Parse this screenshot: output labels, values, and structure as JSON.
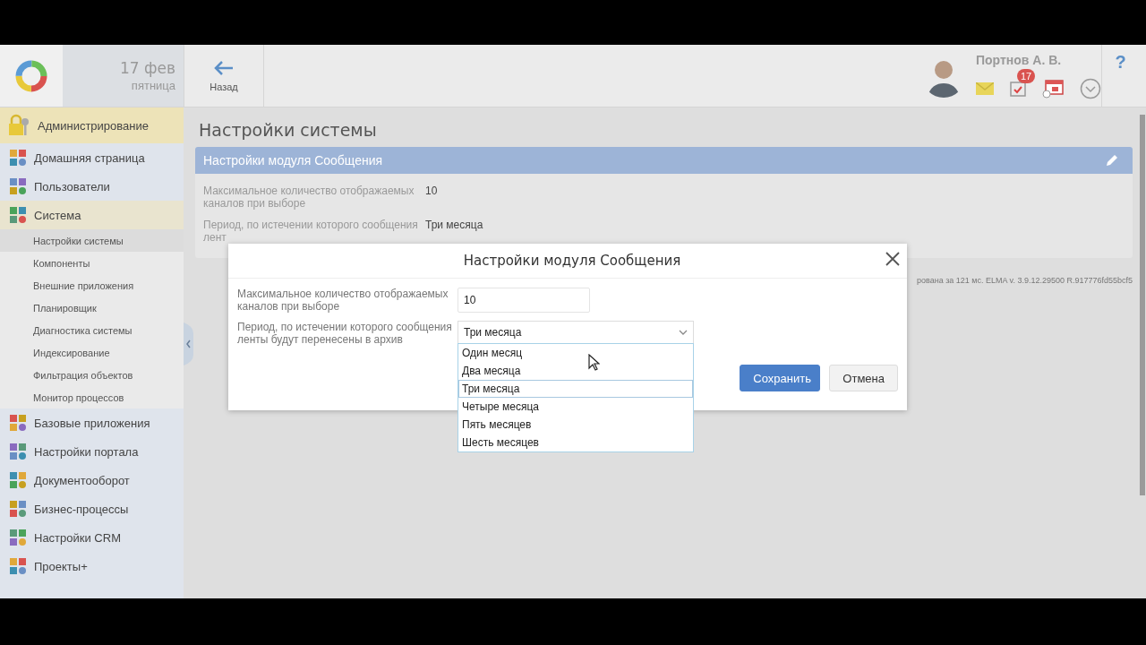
{
  "header": {
    "date": "17 фев",
    "weekday": "пятница",
    "back_label": "Назад",
    "user_name": "Портнов А. В.",
    "tasks_badge": "17",
    "help": "?"
  },
  "sidebar": {
    "module": {
      "label": "Администрирование",
      "selected": true
    },
    "items": [
      {
        "label": "Домашняя страница",
        "selected": false
      },
      {
        "label": "Пользователи",
        "selected": false
      },
      {
        "label": "Система",
        "selected": true,
        "children": [
          {
            "label": "Настройки системы",
            "selected": true
          },
          {
            "label": "Компоненты",
            "selected": false
          },
          {
            "label": "Внешние приложения",
            "selected": false
          },
          {
            "label": "Планировщик",
            "selected": false
          },
          {
            "label": "Диагностика системы",
            "selected": false
          },
          {
            "label": "Индексирование",
            "selected": false
          },
          {
            "label": "Фильтрация объектов",
            "selected": false
          },
          {
            "label": "Монитор процессов",
            "selected": false
          }
        ]
      },
      {
        "label": "Базовые приложения",
        "selected": false
      },
      {
        "label": "Настройки портала",
        "selected": false
      },
      {
        "label": "Документооборот",
        "selected": false
      },
      {
        "label": "Бизнес-процессы",
        "selected": false
      },
      {
        "label": "Настройки CRM",
        "selected": false
      },
      {
        "label": "Проекты+",
        "selected": false
      }
    ]
  },
  "page": {
    "title": "Настройки системы",
    "panel": {
      "title": "Настройки модуля Сообщения",
      "rows": [
        {
          "label": "Максимальное количество отображаемых каналов при выборе",
          "value": "10"
        },
        {
          "label": "Период, по истечении которого сообщения",
          "label_cut": "лент",
          "value": "Три месяца"
        }
      ]
    },
    "footer": "рована за 121 мс. ELMA v. 3.9.12.29500 R.917776fd55bcf5"
  },
  "dialog": {
    "title": "Настройки модуля Сообщения",
    "fields": [
      {
        "kind": "text",
        "label": "Максимальное количество отображаемых каналов при выборе",
        "value": "10"
      },
      {
        "kind": "select",
        "label": "Период, по истечении которого сообщения ленты будут перенесены в архив",
        "value": "Три месяца",
        "expanded": true,
        "options": [
          {
            "label": "Один месяц",
            "selected": false
          },
          {
            "label": "Два месяца",
            "selected": false
          },
          {
            "label": "Три месяца",
            "selected": true
          },
          {
            "label": "Четыре месяца",
            "selected": false
          },
          {
            "label": "Пять месяцев",
            "selected": false
          },
          {
            "label": "Шесть месяцев",
            "selected": false
          }
        ]
      }
    ],
    "buttons": [
      {
        "kind": "primary",
        "label": "Сохранить"
      },
      {
        "kind": "secondary",
        "label": "Отмена"
      }
    ]
  }
}
